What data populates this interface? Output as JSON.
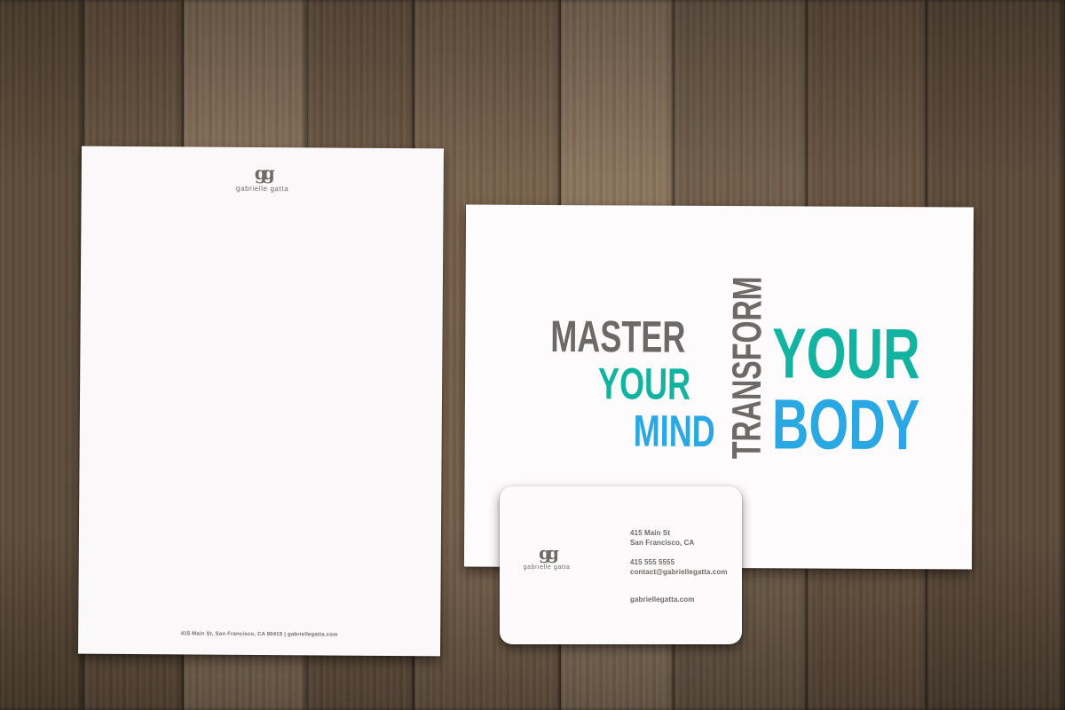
{
  "letterhead": {
    "monogram": "gg",
    "brand_name": "gabrielle gatta",
    "footer": "415 Main St, San Francisco, CA 90415 | gabriellegatta.com"
  },
  "postcard": {
    "word_master": "MASTER",
    "word_your_1": "YOUR",
    "word_mind": "MIND",
    "word_transform": "TRANSFORM",
    "word_your_2": "YOUR",
    "word_body": "BODY",
    "colors": {
      "gray": "#6d6966",
      "teal": "#13b3a1",
      "blue": "#29a8e3"
    }
  },
  "business_card": {
    "monogram": "gg",
    "brand_name": "gabrielle gatta",
    "address_line1": "415 Main St",
    "address_line2": "San Francisco, CA",
    "phone": "415 555 5555",
    "email": "contact@gabriellegatta.com",
    "website": "gabriellegatta.com"
  }
}
